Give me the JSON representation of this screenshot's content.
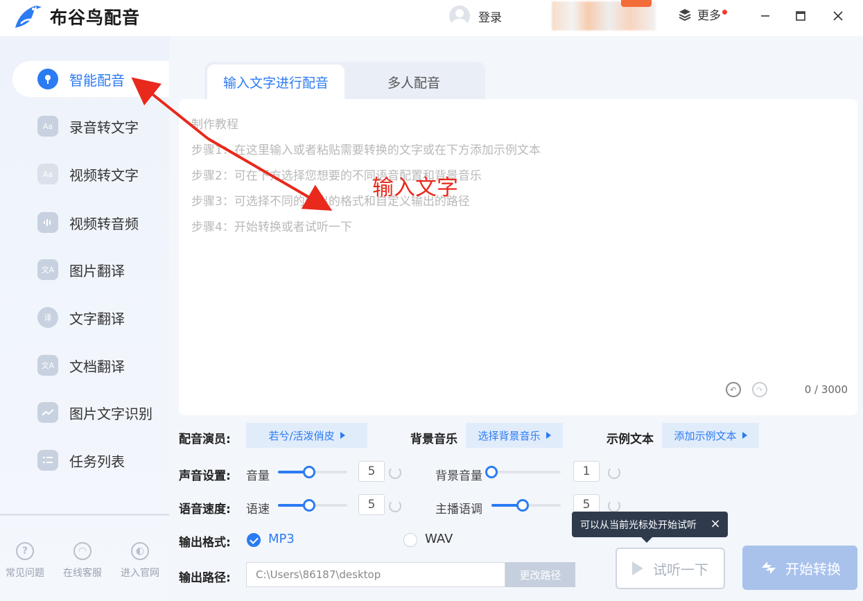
{
  "app": {
    "title": "布谷鸟配音"
  },
  "header": {
    "login_label": "登录",
    "more_label": "更多",
    "icons": {
      "user": "user-avatar-icon",
      "layers": "layers-icon"
    }
  },
  "sidebar": {
    "items": [
      {
        "label": "智能配音",
        "icon": "microphone-icon",
        "active": true
      },
      {
        "label": "录音转文字",
        "icon": "aa-text-icon"
      },
      {
        "label": "视频转文字",
        "icon": "video-text-icon"
      },
      {
        "label": "视频转音频",
        "icon": "video-audio-icon"
      },
      {
        "label": "图片翻译",
        "icon": "translate-icon"
      },
      {
        "label": "文字翻译",
        "icon": "chat-translate-icon"
      },
      {
        "label": "文档翻译",
        "icon": "doc-translate-icon"
      },
      {
        "label": "图片文字识别",
        "icon": "image-ocr-icon"
      },
      {
        "label": "任务列表",
        "icon": "task-list-icon"
      }
    ],
    "footer": [
      {
        "label": "常见问题",
        "icon": "question-icon"
      },
      {
        "label": "在线客服",
        "icon": "headset-icon"
      },
      {
        "label": "进入官网",
        "icon": "globe-icon"
      }
    ]
  },
  "tabs": [
    {
      "label": "输入文字进行配音",
      "active": true
    },
    {
      "label": "多人配音",
      "active": false
    }
  ],
  "editor": {
    "lines": [
      "制作教程",
      "步骤1：在这里输入或者粘贴需要转换的文字或在下方添加示例文本",
      "步骤2：可在下方选择您想要的不同语音配置和背景音乐",
      "步骤3：可选择不同的输出的格式和自定义输出的路径",
      "步骤4：开始转换或者试听一下"
    ],
    "char_count": "0 / 3000"
  },
  "annotation": {
    "text": "输入文字",
    "color": "#e8291c"
  },
  "controls": {
    "voice_actor_label": "配音演员:",
    "voice_actor_value": "若兮/活泼俏皮",
    "bgm_label": "背景音乐",
    "bgm_button": "选择背景音乐",
    "sample_label": "示例文本",
    "sample_button": "添加示例文本",
    "sound_label": "声音设置:",
    "volume_label": "音量",
    "volume_value": "5",
    "volume_fraction": 0.45,
    "bg_volume_label": "背景音量",
    "bg_volume_value": "1",
    "bg_volume_fraction": 0.0,
    "speed_row_label": "语音速度:",
    "speed_label": "语速",
    "speed_value": "5",
    "speed_fraction": 0.45,
    "pitch_label": "主播语调",
    "pitch_value": "5",
    "pitch_fraction": 0.45,
    "format_label": "输出格式:",
    "format_options": [
      "MP3",
      "WAV"
    ],
    "format_selected": "MP3",
    "path_label": "输出路径:",
    "path_value": "C:\\Users\\86187\\desktop",
    "path_button": "更改路径"
  },
  "tooltip": {
    "text": "可以从当前光标处开始试听"
  },
  "actions": {
    "preview": "试听一下",
    "convert": "开始转换"
  },
  "colors": {
    "accent": "#2b7bf3",
    "disabled_primary": "#a9c2ec"
  }
}
